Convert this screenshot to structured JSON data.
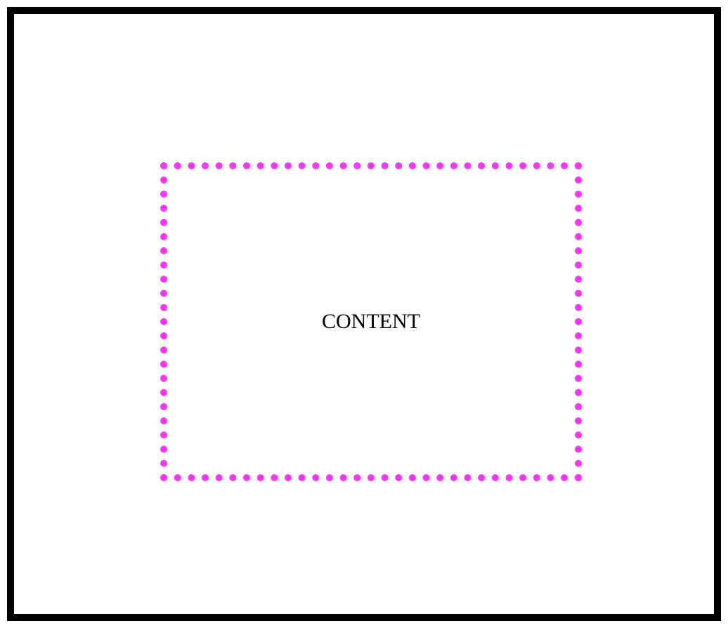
{
  "colors": {
    "outer_border": "#000000",
    "inner_border": "#ff33ff",
    "background": "#ffffff",
    "text": "#000000"
  },
  "content_box": {
    "label": "CONTENT",
    "border_style": "dotted"
  }
}
